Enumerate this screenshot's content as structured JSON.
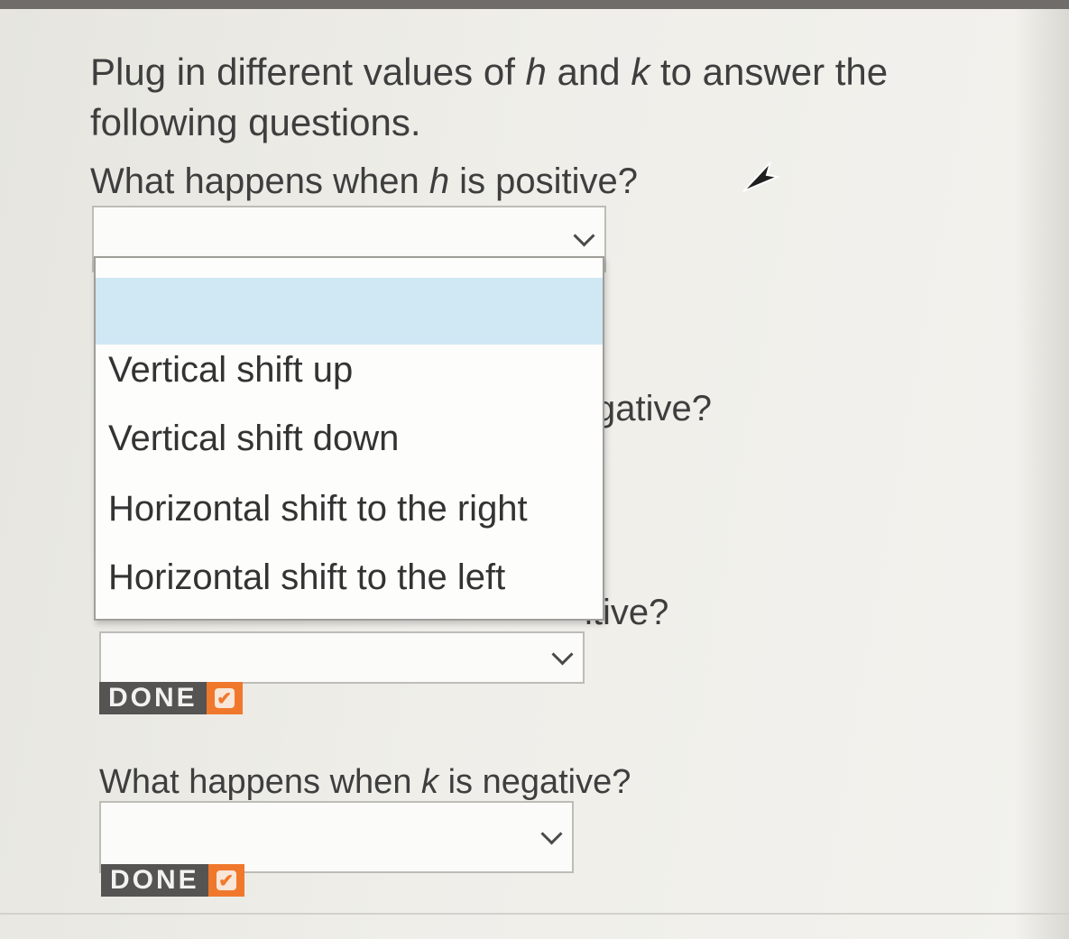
{
  "intro": {
    "part1": "Plug in different values of ",
    "var_h": "h",
    "part2": " and ",
    "var_k": "k",
    "part3": " to answer the following questions."
  },
  "q1": {
    "pre": "What happens when ",
    "var": "h",
    "post": " is positive?"
  },
  "q2_partial": "gative?",
  "q3_partial": "itive?",
  "q4": {
    "pre": "What happens when ",
    "var": "k",
    "post": " is negative?"
  },
  "dropdown": {
    "options": [
      "Vertical shift up",
      "Vertical shift down",
      "Horizontal shift to the right",
      "Horizontal shift to the left"
    ]
  },
  "done_label": "DONE",
  "icons": {
    "chevron": "chevron-down-icon",
    "check": "checkmark-icon",
    "cursor": "mouse-pointer-icon"
  },
  "colors": {
    "done_bg": "#555452",
    "done_check": "#f0782c",
    "highlight": "#cfe8f4"
  }
}
